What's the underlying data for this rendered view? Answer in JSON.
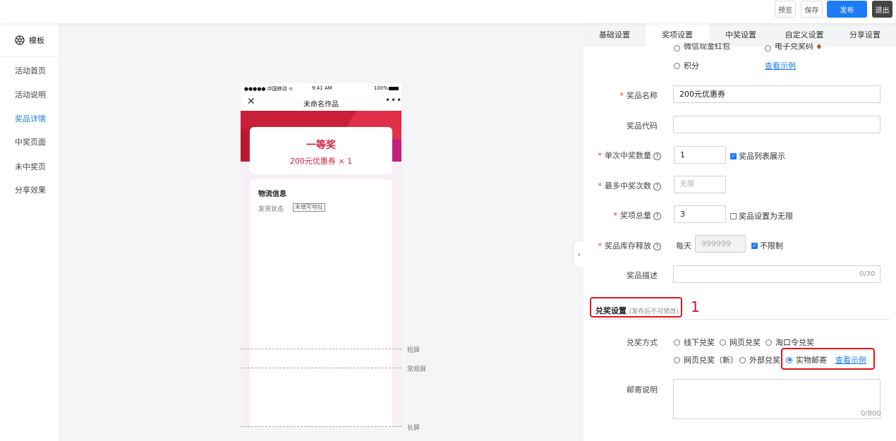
{
  "toolbar": {
    "preview": "预览",
    "save": "保存",
    "publish": "发布",
    "exit": "退出"
  },
  "sidebar": {
    "header": "模板",
    "items": [
      {
        "label": "活动首页"
      },
      {
        "label": "活动说明"
      },
      {
        "label": "奖品详情"
      },
      {
        "label": "中奖页面"
      },
      {
        "label": "未中奖页"
      },
      {
        "label": "分享效果"
      }
    ],
    "active_index": 2
  },
  "phone": {
    "status_left": "●●●●● 中国移动 ᯤ",
    "status_time": "9:41 AM",
    "status_right": "100%",
    "title": "未命名作品",
    "prize_level": "一等奖",
    "prize_line": "200元优惠券  × 1",
    "logistics_title": "物流信息",
    "shipping_label": "发货状态",
    "shipping_badge": "未填写地址"
  },
  "screen_markers": [
    "短屏",
    "常规屏",
    "长屏"
  ],
  "tabs": [
    "基础设置",
    "奖项设置",
    "中奖设置",
    "自定义设置",
    "分享设置"
  ],
  "active_tab": 1,
  "partial_options": {
    "a": "微信现金红包",
    "b": "电子兑奖码",
    "points": "积分"
  },
  "example_link": "查看示例",
  "form": {
    "prize_name": {
      "label": "奖品名称",
      "value": "200元优惠券"
    },
    "prize_code": {
      "label": "奖品代码",
      "value": ""
    },
    "per_win": {
      "label": "单次中奖数量",
      "value": "1",
      "check_label": "奖品列表展示"
    },
    "max_win": {
      "label": "最多中奖次数",
      "placeholder": "无限"
    },
    "total": {
      "label": "奖项总量",
      "value": "3",
      "check_label": "奖品设置为无限"
    },
    "stock_release": {
      "label": "奖品库存释放",
      "prefix": "每天",
      "placeholder": "999999",
      "check_label": "不限制"
    },
    "desc": {
      "label": "奖品描述",
      "counter": "0/30"
    }
  },
  "redeem": {
    "title": "兑奖设置",
    "hint": "(发布后不可修改)",
    "method_label": "兑奖方式",
    "options": [
      "线下兑奖",
      "网页兑奖",
      "淘口令兑奖",
      "网页兑奖（新）",
      "外部兑奖",
      "实物邮寄"
    ],
    "selected": "实物邮寄",
    "mail_label": "邮寄说明",
    "mail_counter": "0/800"
  },
  "annotations": {
    "marker_1": "1"
  },
  "colors": {
    "accent": "#1b7cf5",
    "annotation": "#e0141c",
    "prize_red": "#d0253c"
  }
}
